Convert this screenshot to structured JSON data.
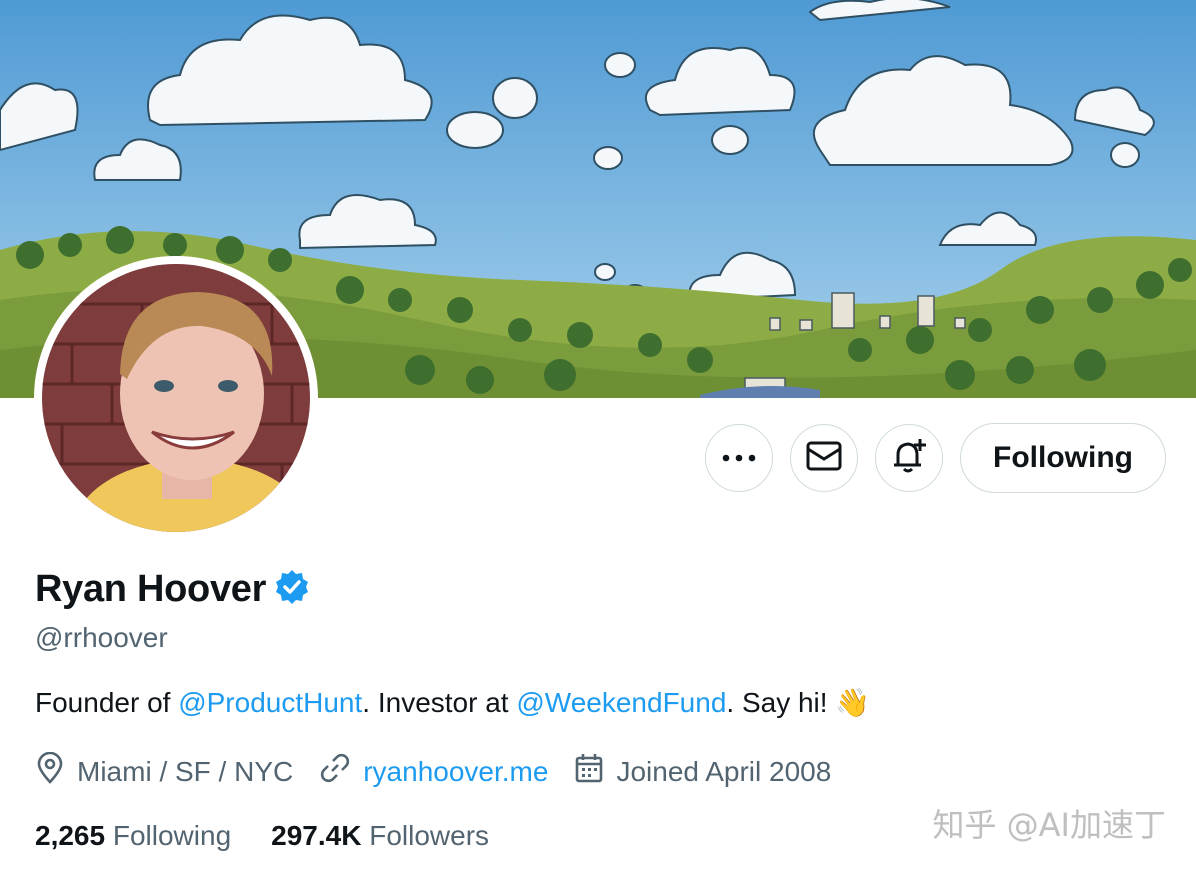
{
  "profile": {
    "display_name": "Ryan Hoover",
    "handle": "@rrhoover",
    "verified": true,
    "bio": {
      "prefix": "Founder of ",
      "mention1": "@ProductHunt",
      "middle": ". Investor at ",
      "mention2": "@WeekendFund",
      "suffix": ". Say hi! ",
      "emoji": "👋"
    },
    "location": "Miami / SF / NYC",
    "website": "ryanhoover.me",
    "joined": "Joined April 2008",
    "following_count": "2,265",
    "following_label": "Following",
    "followers_count": "297.4K",
    "followers_label": "Followers"
  },
  "actions": {
    "more_icon": "more-icon",
    "message_icon": "mail-icon",
    "notify_icon": "bell-plus-icon",
    "follow_label": "Following"
  },
  "colors": {
    "accent": "#1d9bf0",
    "text": "#0f1419",
    "muted": "#536471",
    "border": "#cfd9de"
  },
  "watermark": "知乎 @AI加速丁"
}
